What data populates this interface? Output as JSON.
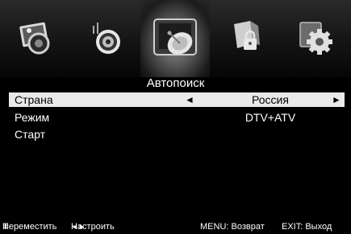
{
  "menu_tabs": [
    {
      "icon": "photo-icon",
      "selected": false
    },
    {
      "icon": "sound-icon",
      "selected": false
    },
    {
      "icon": "satellite-dish-icon",
      "selected": true
    },
    {
      "icon": "lock-icon",
      "selected": false
    },
    {
      "icon": "settings-gear-icon",
      "selected": false
    }
  ],
  "title": "Автопоиск",
  "rows": [
    {
      "label": "Страна",
      "value": "Россия",
      "left_arrow": "◄",
      "right_arrow": "►",
      "selected": true
    },
    {
      "label": "Режим",
      "value": "DTV+ATV",
      "selected": false
    },
    {
      "label": "Старт",
      "value": "",
      "selected": false
    }
  ],
  "footer": {
    "move_icon": "⬍",
    "move": "Переместить",
    "adjust_icon": "◄►",
    "adjust": "Настроить",
    "menu": "MENU: Возврат",
    "exit": "EXIT: Выход"
  },
  "colors": {
    "background": "#000000",
    "highlight": "#e9e9e9",
    "text": "#ffffff"
  }
}
